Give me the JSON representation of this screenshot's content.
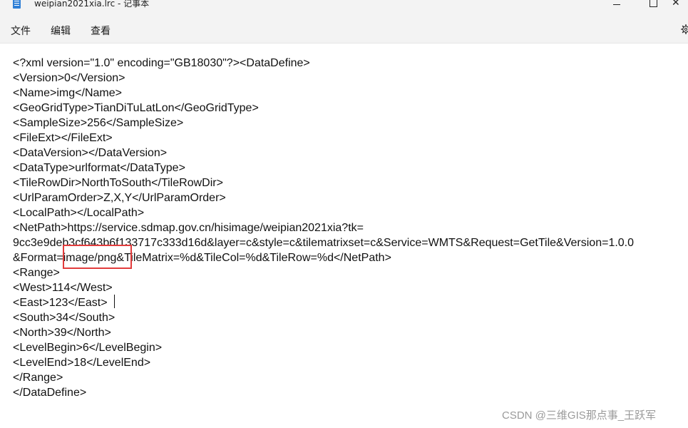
{
  "window": {
    "title": "weipian2021xia.lrc - 记事本",
    "controls": {
      "minimize_glyph": "",
      "maximize_glyph": "",
      "close_glyph": "✕"
    }
  },
  "menu": {
    "file": "文件",
    "edit": "编辑",
    "view": "查看"
  },
  "editor": {
    "lines": [
      "<?xml version=\"1.0\" encoding=\"GB18030\"?><DataDefine>",
      "<Version>0</Version>",
      "<Name>img</Name>",
      "<GeoGridType>TianDiTuLatLon</GeoGridType>",
      "<SampleSize>256</SampleSize>",
      "<FileExt></FileExt>",
      "<DataVersion></DataVersion>",
      "<DataType>urlformat</DataType>",
      "<TileRowDir>NorthToSouth</TileRowDir>",
      "<UrlParamOrder>Z,X,Y</UrlParamOrder>",
      "<LocalPath></LocalPath>",
      "<NetPath>https://service.sdmap.gov.cn/hisimage/weipian2021xia?tk=",
      "9cc3e9deb3cf643b6f133717c333d16d&layer=c&style=c&tilematrixset=c&Service=WMTS&Request=GetTile&Version=1.0.0",
      "&Format=image/png&TileMatrix=%d&TileCol=%d&TileRow=%d</NetPath>",
      "<Range>",
      "<West>114</West>",
      "<East>123</East>",
      "<South>34</South>",
      "<North>39</North>",
      "<LevelBegin>6</LevelBegin>",
      "<LevelEnd>18</LevelEnd>",
      "</Range>",
      "</DataDefine>"
    ]
  },
  "watermark": "CSDN @三维GIS那点事_王跃军",
  "colors": {
    "highlight": "#e23c3c",
    "chrome": "#f3f3f3",
    "text": "#111111"
  }
}
